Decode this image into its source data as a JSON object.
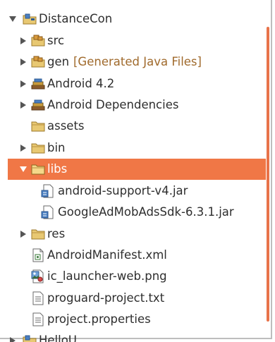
{
  "tree": {
    "project": {
      "label": "DistanceCon"
    },
    "items": [
      {
        "label": "src",
        "icon": "package-folder-icon"
      },
      {
        "label": "gen",
        "decoration": "[Generated Java Files]",
        "icon": "package-folder-icon"
      },
      {
        "label": "Android 4.2",
        "icon": "library-icon"
      },
      {
        "label": "Android Dependencies",
        "icon": "library-icon"
      },
      {
        "label": "assets",
        "icon": "folder-icon"
      },
      {
        "label": "bin",
        "icon": "folder-icon"
      },
      {
        "label": "libs",
        "icon": "folder-icon",
        "selected": true
      },
      {
        "label": "android-support-v4.jar",
        "icon": "jar-icon"
      },
      {
        "label": "GoogleAdMobAdsSdk-6.3.1.jar",
        "icon": "jar-icon"
      },
      {
        "label": "res",
        "icon": "folder-icon"
      },
      {
        "label": "AndroidManifest.xml",
        "icon": "xml-file-icon"
      },
      {
        "label": "ic_launcher-web.png",
        "icon": "image-file-icon"
      },
      {
        "label": "proguard-project.txt",
        "icon": "text-file-icon"
      },
      {
        "label": "project.properties",
        "icon": "text-file-icon"
      }
    ],
    "next_project": {
      "label": "HelloU"
    }
  },
  "colors": {
    "selection": "#f07746",
    "decoration_text": "#a06a2c",
    "scrollbar": "#e8734a"
  }
}
